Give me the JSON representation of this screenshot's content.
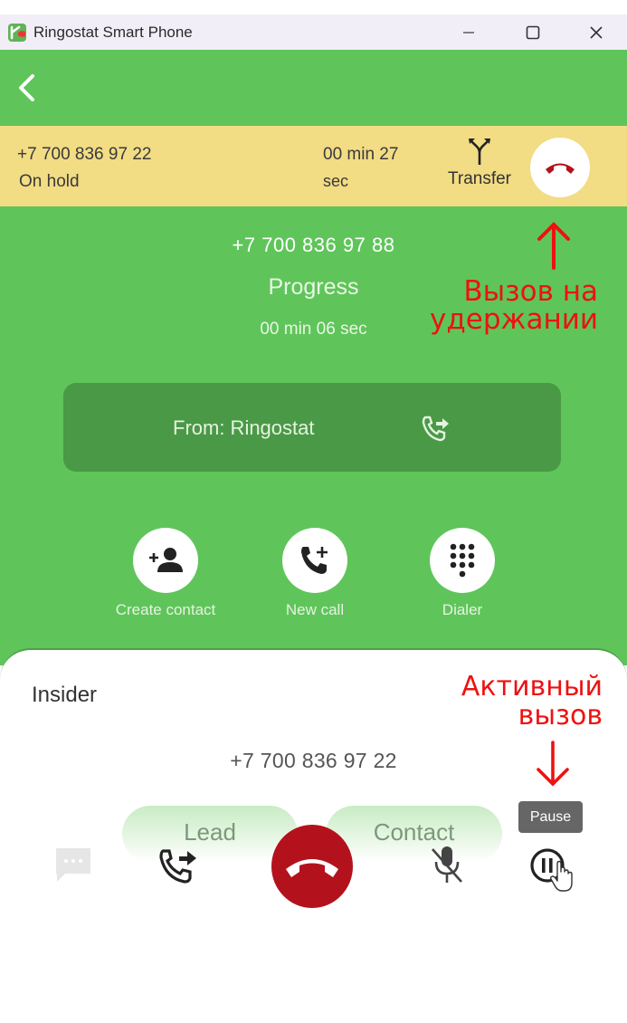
{
  "window": {
    "title": "Ringostat Smart Phone",
    "controls": {
      "minimize": "–",
      "maximize": "☐",
      "close": "✕"
    },
    "logo_icon": "ringostat-logo-icon"
  },
  "header": {
    "back_icon": "chevron-left-icon"
  },
  "held_call": {
    "number": "+7 700 836 97 22",
    "status": "On hold",
    "duration_line1": "00 min  27",
    "duration_line2": "sec",
    "transfer_label": "Transfer",
    "transfer_icon": "merge-arrows-icon",
    "hangup_icon": "phone-hangup-icon"
  },
  "current_call": {
    "number": "+7 700 836 97 88",
    "status": "Progress",
    "duration": "00 min  06 sec"
  },
  "from_line": {
    "label": "From: Ringostat",
    "icon": "phone-forward-icon"
  },
  "actions": [
    {
      "label": "Create contact",
      "icon": "add-person-icon"
    },
    {
      "label": "New call",
      "icon": "phone-add-icon"
    },
    {
      "label": "Dialer",
      "icon": "dialpad-icon"
    }
  ],
  "active_call_sheet": {
    "name": "Insider",
    "number": "+7 700 836 97 22",
    "tags": {
      "lead": "Lead",
      "contact": "Contact"
    },
    "controls": {
      "chat_icon": "chat-bubble-icon",
      "transfer_icon": "phone-forward-icon",
      "hangup_icon": "phone-hangup-icon",
      "mute_icon": "mic-off-icon",
      "pause_icon": "pause-circle-icon"
    },
    "tooltip": "Pause",
    "hangup_color": "#b3121c"
  },
  "annotations": {
    "hold_line1": "Вызов на",
    "hold_line2": "удержании",
    "active_line1": "Активный",
    "active_line2": "вызов",
    "color": "#ee1111"
  },
  "colors": {
    "brand_green": "#5fc55a",
    "dark_green": "#4a9946",
    "hold_bar": "#f2dc84"
  }
}
